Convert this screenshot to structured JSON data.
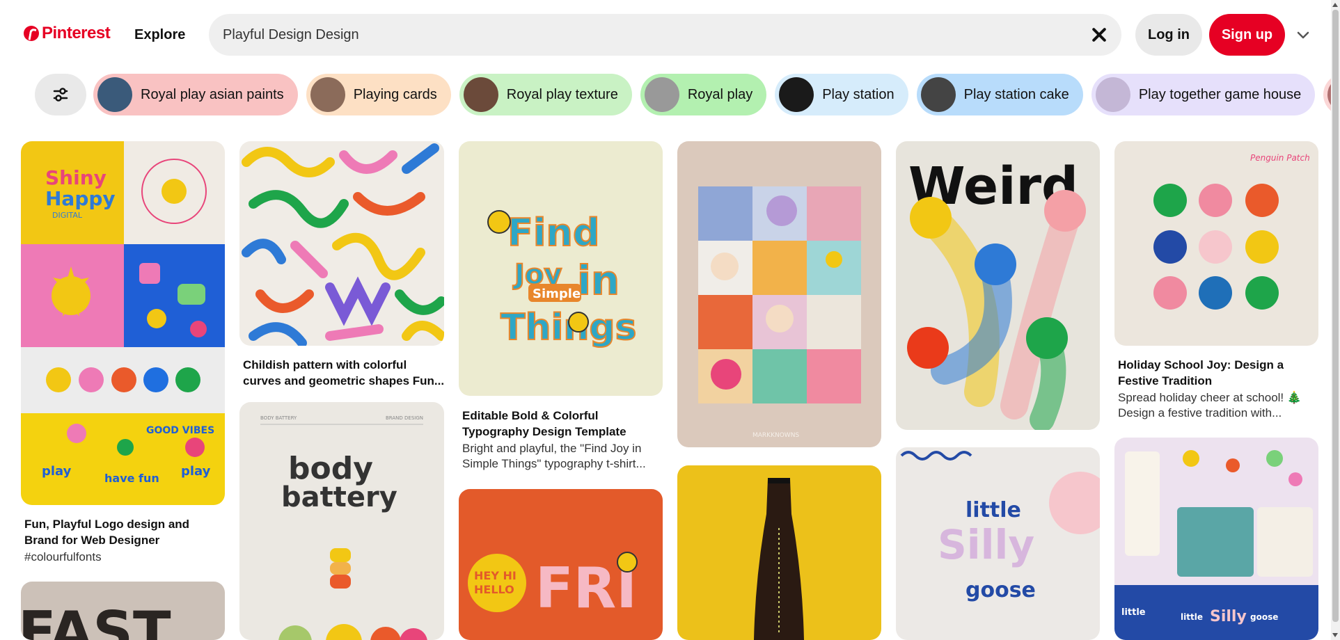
{
  "header": {
    "brand": "Pinterest",
    "explore": "Explore",
    "search_value": "Playful Design Design",
    "login": "Log in",
    "signup": "Sign up"
  },
  "chips": [
    {
      "label": "Royal play asian paints",
      "bg": "#f9c2c2",
      "thumb": "#3a5a7a"
    },
    {
      "label": "Playing cards",
      "bg": "#fde0c4",
      "thumb": "#8b6b5a"
    },
    {
      "label": "Royal play texture",
      "bg": "#c9f2c4",
      "thumb": "#6b4a3a"
    },
    {
      "label": "Royal play",
      "bg": "#b3f0b0",
      "thumb": "#999999"
    },
    {
      "label": "Play station",
      "bg": "#d6ecfb",
      "thumb": "#1a1a1a"
    },
    {
      "label": "Play station cake",
      "bg": "#b8dcfb",
      "thumb": "#444444"
    },
    {
      "label": "Play together game house",
      "bg": "#e6e0fb",
      "thumb": "#c4b7d6"
    },
    {
      "label": "",
      "bg": "#fbd6d6",
      "thumb": "#b07070"
    }
  ],
  "pins": {
    "p1": {
      "title": "Fun, Playful Logo design and Brand for Web Designer",
      "desc": "#colourfulfonts"
    },
    "p2": {
      "title": "Childish pattern with colorful curves and geometric shapes Fun..."
    },
    "p3": {
      "title": "Editable Bold & Colorful Typography Design Template",
      "desc": "Bright and playful, the \"Find Joy in Simple Things\" typography t-shirt..."
    },
    "p4": {
      "title": "Holiday School Joy: Design a Festive Tradition",
      "desc": "Spread holiday cheer at school! 🎄 Design a festive tradition with..."
    }
  },
  "artwork": {
    "shiny_happy": [
      "Shiny",
      "Happy",
      "DIGITAL"
    ],
    "good_vibes": "GOOD VIBES",
    "play": "play",
    "have_fun": "have fun",
    "fast": "FAST",
    "find_joy": [
      "Find",
      "Joy",
      "in",
      "Simple",
      "Things"
    ],
    "body_battery": [
      "body",
      "battery"
    ],
    "body_battery_header": [
      "BODY BATTERY",
      "BRAND DESIGN"
    ],
    "markknowns": "MARKKNOWNS",
    "hey_hi_hello": [
      "HEY HI",
      "HELLO"
    ],
    "fri": "FRI",
    "weird": "Weird",
    "little_silly_goose": [
      "little",
      "Silly",
      "goose"
    ],
    "penguin_patch": "Penguin Patch"
  },
  "colors": {
    "brand": "#e60023"
  }
}
